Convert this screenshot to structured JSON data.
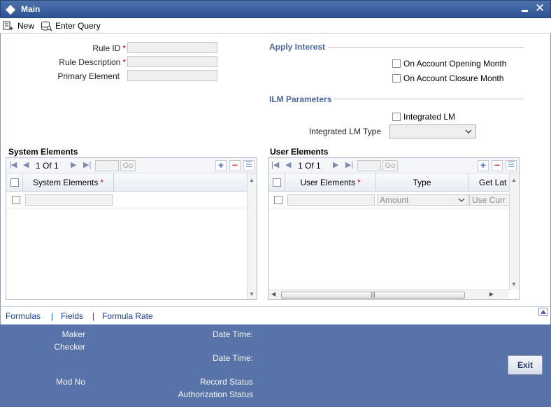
{
  "window": {
    "title": "Main"
  },
  "toolbar": {
    "new_label": "New",
    "enter_query_label": "Enter Query"
  },
  "form": {
    "rule_id_label": "Rule ID",
    "rule_description_label": "Rule Description",
    "primary_element_label": "Primary Element",
    "required_mark": "*"
  },
  "apply_interest": {
    "title": "Apply Interest",
    "on_account_opening_month": "On Account Opening Month",
    "on_account_closure_month": "On Account Closure Month"
  },
  "ilm": {
    "title": "ILM Parameters",
    "integrated_lm": "Integrated LM",
    "integrated_lm_type_label": "Integrated LM Type"
  },
  "system_elements": {
    "title": "System Elements",
    "page_current": "1",
    "page_of": "Of",
    "page_total": "1",
    "go_label": "Go",
    "column_header": "System Elements"
  },
  "user_elements": {
    "title": "User Elements",
    "page_current": "1",
    "page_of": "Of",
    "page_total": "1",
    "go_label": "Go",
    "columns": [
      "User Elements",
      "Type",
      "Get Lat"
    ],
    "row": {
      "type": "Amount",
      "get_latest": "Use Curr"
    }
  },
  "links": {
    "formulas": "Formulas",
    "fields": "Fields",
    "formula_rate": "Formula Rate",
    "separator": "|"
  },
  "audit": {
    "maker": "Maker",
    "checker": "Checker",
    "date_time_1": "Date Time:",
    "date_time_2": "Date Time:",
    "mod_no": "Mod No",
    "record_status": "Record Status",
    "authorization_status": "Authorization Status"
  },
  "exit_label": "Exit"
}
